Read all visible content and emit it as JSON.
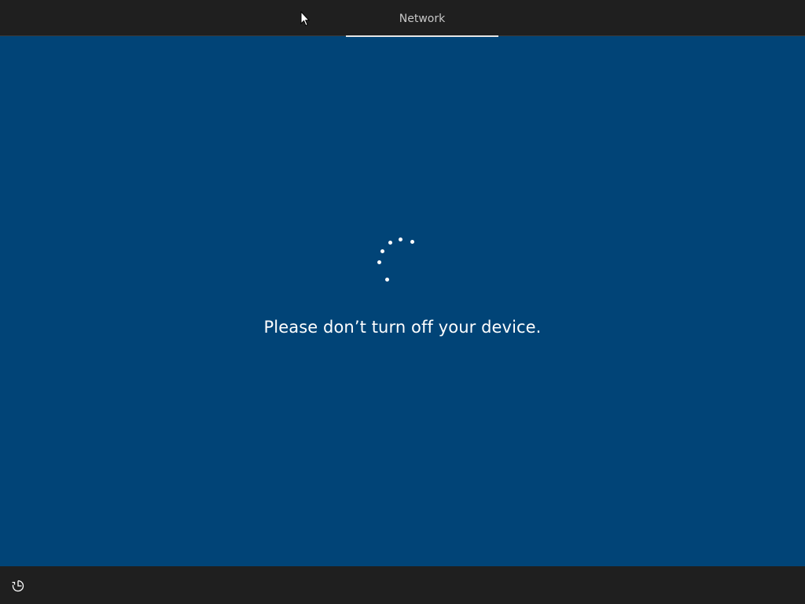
{
  "header": {
    "tabs": [
      {
        "label": "Network",
        "active": true
      }
    ]
  },
  "main": {
    "status_message": "Please don’t turn off your device.",
    "spinner_icon": "loading-dots-icon"
  },
  "footer": {
    "accessibility_icon": "ease-of-access-icon"
  },
  "colors": {
    "background": "#014477",
    "bars": "#1f1f1f",
    "text": "#ffffff",
    "tab_text": "#c8c8c8"
  }
}
